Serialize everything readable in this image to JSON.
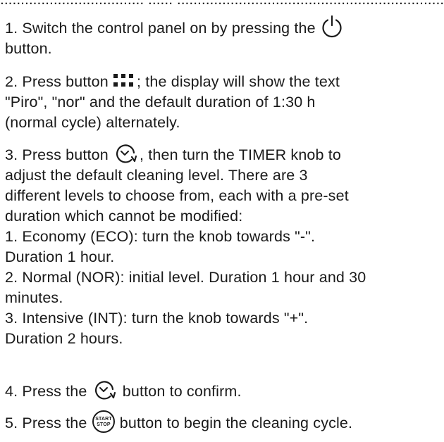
{
  "top_cut_text": "................................... ...... ....................................................................",
  "steps": {
    "s1": {
      "pre": "1. Switch the control panel on by pressing the",
      "post": "button."
    },
    "s2": {
      "pre": "2. Press button",
      "post1": "; the display will show the text",
      "line2": "\"Piro\", \"nor\" and the default duration of 1:30 h",
      "line3": "(normal cycle) alternately."
    },
    "s3": {
      "pre": "3. Press button",
      "post1": ", then turn the TIMER knob to",
      "line2": "adjust the default cleaning level. There are 3",
      "line3": "different levels to choose from, each with a pre-set",
      "line4": "duration which cannot be modified:",
      "line5": "1. Economy (ECO): turn the knob towards \"-\".",
      "line6": "Duration 1 hour.",
      "line7": "2. Normal (NOR): initial level. Duration 1 hour and 30",
      "line8": "minutes.",
      "line9": "3. Intensive (INT): turn the knob towards \"+\".",
      "line10": "Duration 2 hours."
    },
    "s4": {
      "pre": "4. Press the",
      "post": "button to confirm."
    },
    "s5": {
      "pre": "5. Press the",
      "post": "button to begin the cleaning cycle."
    }
  },
  "icons": {
    "power": "power-icon",
    "grid": "grid-icon",
    "clock": "clock-icon",
    "startstop": "start-stop-icon",
    "start_label": "START",
    "stop_label": "STOP"
  }
}
